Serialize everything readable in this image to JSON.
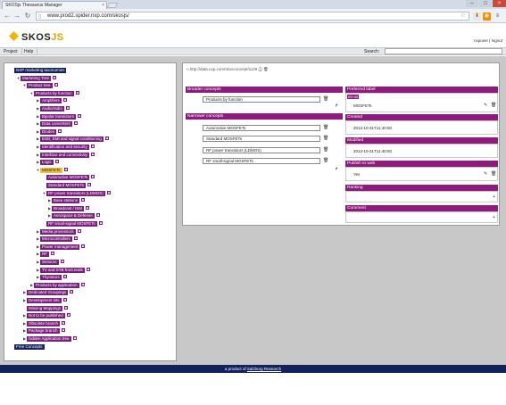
{
  "browser": {
    "tab_title": "SKOSjs Thesaurus Manager",
    "tab_close": "×",
    "address": "www.prod2.spider.nxp.com/skosjs/",
    "win_min": "–",
    "win_max": "□",
    "win_close": "×"
  },
  "app": {
    "logo_text": "SKOS",
    "logo_suffix": "JS",
    "user": "nxpuser",
    "logout": "logout",
    "separator": "|"
  },
  "menu": {
    "project": "Project",
    "help": "Help",
    "search_label": "Search:",
    "search_value": ""
  },
  "tree": [
    {
      "label": "NXP marketing taxonomies",
      "level": 0,
      "kind": "root",
      "toggle": ""
    },
    {
      "label": "Marketing Tree",
      "level": 1,
      "toggle": "▼"
    },
    {
      "label": "Product tree",
      "level": 2,
      "toggle": "▼"
    },
    {
      "label": "Products by function",
      "level": 3,
      "toggle": "▼"
    },
    {
      "label": "Amplifiers",
      "level": 4,
      "toggle": "▶"
    },
    {
      "label": "Audio/radio",
      "level": 4,
      "toggle": "▶"
    },
    {
      "label": "Bipolar transistors",
      "level": 4,
      "toggle": "▶"
    },
    {
      "label": "Data converters",
      "level": 4,
      "toggle": "▶"
    },
    {
      "label": "Diodes",
      "level": 4,
      "toggle": "▶"
    },
    {
      "label": "ESD, EMI and signal conditioning",
      "level": 4,
      "toggle": "▶"
    },
    {
      "label": "Identification and security",
      "level": 4,
      "toggle": "▶"
    },
    {
      "label": "Interface and connectivity",
      "level": 4,
      "toggle": "▶"
    },
    {
      "label": "Logic",
      "level": 4,
      "toggle": "▶"
    },
    {
      "label": "MOSFETs",
      "level": 4,
      "toggle": "▼",
      "kind": "sel"
    },
    {
      "label": "Automotive MOSFETs",
      "level": 5,
      "toggle": ""
    },
    {
      "label": "Standard MOSFETs",
      "level": 5,
      "toggle": ""
    },
    {
      "label": "RF power transistors (LDMOS)",
      "level": 5,
      "toggle": "▼"
    },
    {
      "label": "Base stations",
      "level": 6,
      "toggle": "▶"
    },
    {
      "label": "Broadcast / ISM",
      "level": 6,
      "toggle": "▶"
    },
    {
      "label": "Aerospace & Defense",
      "level": 6,
      "toggle": "▶"
    },
    {
      "label": "RF small-signal MOSFETs",
      "level": 5,
      "toggle": ""
    },
    {
      "label": "Media processors",
      "level": 4,
      "toggle": "▶"
    },
    {
      "label": "Microcontrollers",
      "level": 4,
      "toggle": "▶"
    },
    {
      "label": "Power management",
      "level": 4,
      "toggle": "▶"
    },
    {
      "label": "RF",
      "level": 4,
      "toggle": "▶"
    },
    {
      "label": "Sensors",
      "level": 4,
      "toggle": "▶"
    },
    {
      "label": "TV and STB front ends",
      "level": 4,
      "toggle": "▶"
    },
    {
      "label": "Thyristors",
      "level": 4,
      "toggle": "▶"
    },
    {
      "label": "Products by application",
      "level": 3,
      "toggle": "▶"
    },
    {
      "label": "Dedicated Groupings",
      "level": 2,
      "toggle": "▶"
    },
    {
      "label": "Development kits",
      "level": 2,
      "toggle": "▶"
    },
    {
      "label": "Missing Mappings",
      "level": 2,
      "toggle": ""
    },
    {
      "label": "Not to be published",
      "level": 2,
      "toggle": "▶"
    },
    {
      "label": "Obsolete branch",
      "level": 2,
      "toggle": "▶"
    },
    {
      "label": "Package branch",
      "level": 2,
      "toggle": "▶"
    },
    {
      "label": "hidden Application tree",
      "level": 2,
      "toggle": "▶"
    },
    {
      "label": "Free Concepts",
      "level": 0,
      "kind": "root",
      "toggle": ""
    }
  ],
  "detail": {
    "uri": "http://data.nxp.com/skosconcept/1129",
    "broader_title": "Broader concepts",
    "broader": [
      "Products by function"
    ],
    "narrower_title": "Narrower concepts",
    "narrower": [
      "Automotive MOSFETs",
      "Standard MOSFETs",
      "RF power transistors (LDMOS)",
      "RF small-signal MOSFETs"
    ],
    "pref_label_title": "Preferred label",
    "lang": "en-us",
    "pref_label": "MOSFETs",
    "created_title": "Created",
    "created": "2013-10-31T11:40:50",
    "modified_title": "Modified",
    "modified": "2013-10-31T11:40:50",
    "publish_title": "Publish to web",
    "publish": "Yes",
    "ranking_title": "Ranking",
    "comment_title": "Comment"
  },
  "footer": {
    "prefix": "a product of",
    "link": "Salzburg Research"
  },
  "colors": {
    "purple": "#7a1f7e",
    "navy": "#13215c",
    "selected": "#f1bd3a"
  }
}
